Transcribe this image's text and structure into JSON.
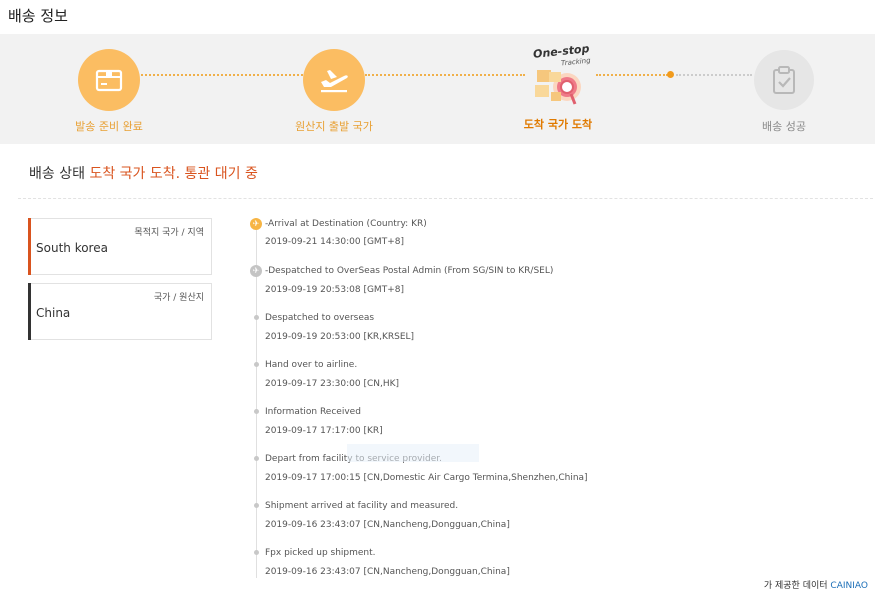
{
  "page_title": "배송 정보",
  "steps": [
    {
      "label": "발송 준비 완료",
      "state": "done",
      "icon": "package-icon"
    },
    {
      "label": "원산지 출발 국가",
      "state": "done",
      "icon": "airplane-departure-icon"
    },
    {
      "label": "도착 국가 도착",
      "state": "current",
      "icon": "one-stop-tracking-icon"
    },
    {
      "label": "배송 성공",
      "state": "pending",
      "icon": "clipboard-check-icon"
    }
  ],
  "tracking_badge": {
    "line1": "One-stop",
    "line2": "Tracking"
  },
  "status": {
    "prefix": "배송 상태",
    "value": "도착 국가 도착. 통관 대기 중"
  },
  "destination": {
    "caption": "목적지 국가 / 지역",
    "value": "South korea"
  },
  "origin": {
    "caption": "국가 / 원산지",
    "value": "China"
  },
  "events": [
    {
      "desc": "-Arrival at Destination (Country: KR)",
      "time": "2019-09-21 14:30:00 [GMT+8]"
    },
    {
      "desc": "-Despatched to OverSeas Postal Admin (From SG/SIN to KR/SEL)",
      "time": "2019-09-19 20:53:08 [GMT+8]"
    },
    {
      "desc": "Despatched  to overseas",
      "time": "2019-09-19 20:53:00 [KR,KRSEL]"
    },
    {
      "desc": "Hand over to airline.",
      "time": "2019-09-17 23:30:00 [CN,HK]"
    },
    {
      "desc": "Information Received",
      "time": "2019-09-17 17:17:00 [KR]"
    },
    {
      "desc": "Depart from facility to service provider.",
      "time": "2019-09-17 17:00:15 [CN,Domestic Air Cargo Termina,Shenzhen,China]"
    },
    {
      "desc": "Shipment arrived at facility and measured.",
      "time": "2019-09-16 23:43:07 [CN,Nancheng,Dongguan,China]"
    },
    {
      "desc": "Fpx picked up shipment.",
      "time": "2019-09-16 23:43:07 [CN,Nancheng,Dongguan,China]"
    }
  ],
  "footer": {
    "text": "가 제공한 데이터",
    "brand": "CAINIAO"
  },
  "colors": {
    "accent": "#fbbd62",
    "current": "#e07a00",
    "status_highlight": "#d9541f",
    "destination_bar": "#d9541f",
    "origin_bar": "#333333",
    "brand": "#1c6fb8"
  }
}
